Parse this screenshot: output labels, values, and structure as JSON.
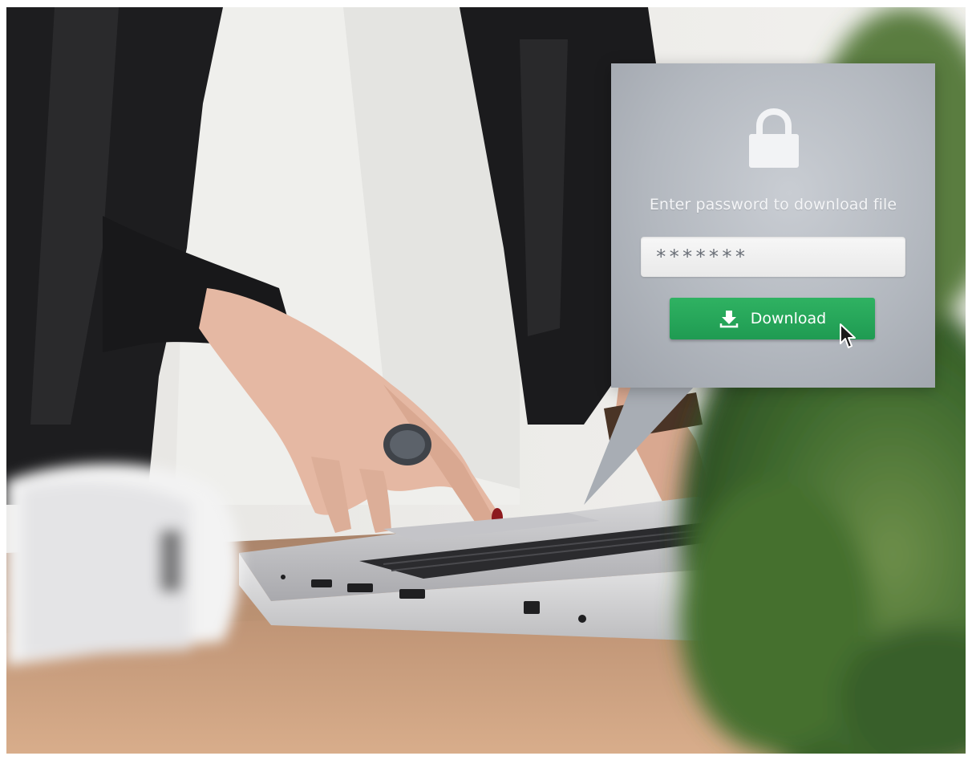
{
  "scene": {
    "description_icons": [
      "lock-icon",
      "download-icon",
      "mouse-pointer-icon"
    ],
    "colors": {
      "button_green": "#23a457",
      "popup_grey": "#b6bac1",
      "jacket": "#1c1c1e",
      "shirt": "#f1f1ef",
      "table_wood": "#b98b68",
      "plant_green": "#4f7a3a"
    }
  },
  "dialog": {
    "prompt": "Enter password to download file",
    "password_value": "*******",
    "download_label": "Download"
  }
}
